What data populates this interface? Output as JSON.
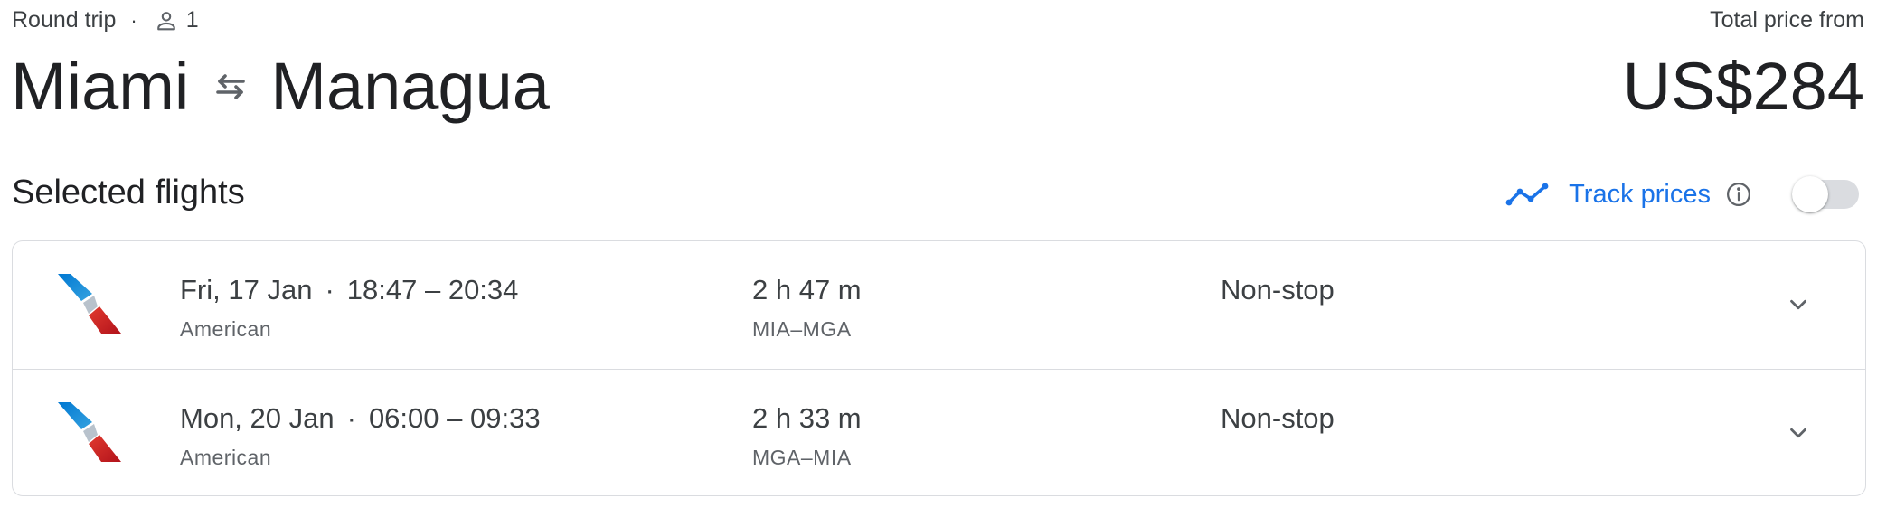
{
  "header": {
    "trip_type": "Round trip",
    "separator": "·",
    "passengers": "1",
    "origin": "Miami",
    "destination": "Managua",
    "price_label": "Total price from",
    "price": "US$284"
  },
  "section": {
    "title": "Selected flights",
    "track_label": "Track prices",
    "track_enabled": false
  },
  "flights": [
    {
      "date": "Fri, 17 Jan",
      "times": "18:47 – 20:34",
      "airline": "American",
      "duration": "2 h 47 m",
      "route": "MIA–MGA",
      "stops": "Non-stop"
    },
    {
      "date": "Mon, 20 Jan",
      "times": "06:00 – 09:33",
      "airline": "American",
      "duration": "2 h 33 m",
      "route": "MGA–MIA",
      "stops": "Non-stop"
    }
  ],
  "icons": {
    "person": "person-icon",
    "swap": "swap-arrows-icon",
    "trend": "trend-line-icon",
    "info": "info-icon",
    "expand": "chevron-down-icon",
    "airline_logo": "american-airlines-logo"
  },
  "colors": {
    "accent": "#1a73e8",
    "text_primary": "#202124",
    "text_secondary": "#5f6368",
    "border": "#dadce0"
  }
}
